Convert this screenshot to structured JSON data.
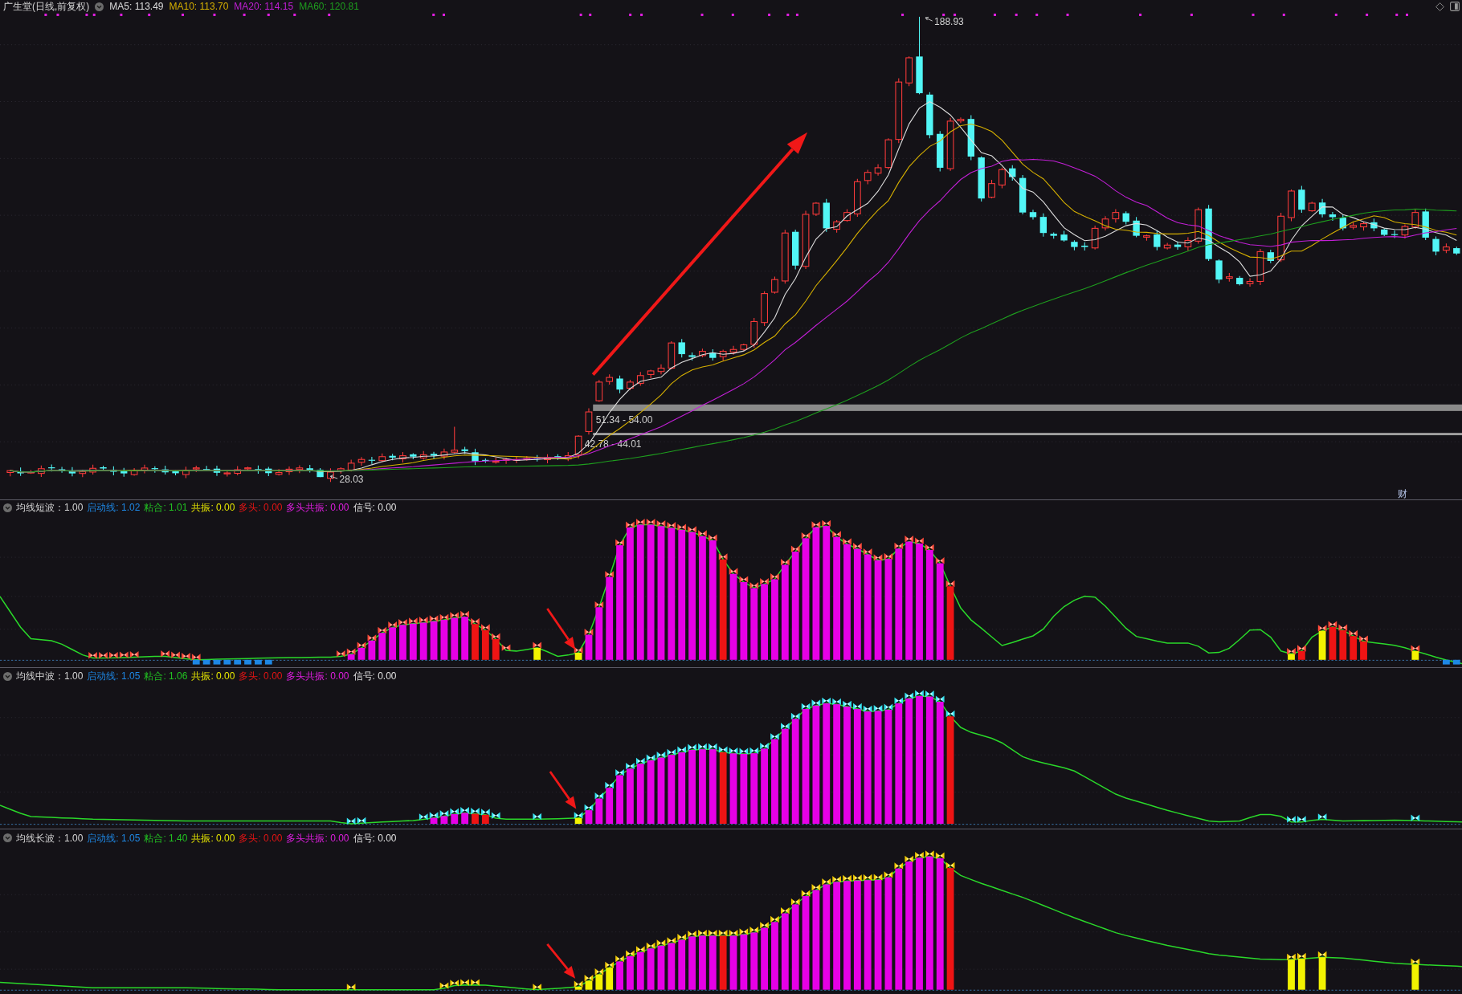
{
  "main_chart": {
    "title": "广生堂(日线,前复权)",
    "legend": [
      {
        "label": "MA5: 113.49",
        "color": "#dcdcdc"
      },
      {
        "label": "MA10: 113.70",
        "color": "#d6b000"
      },
      {
        "label": "MA20: 114.15",
        "color": "#c21fd6"
      },
      {
        "label": "MA60: 120.81",
        "color": "#1e9e1e"
      }
    ],
    "high_label": "188.93",
    "low_label": "28.03",
    "price_bands": [
      {
        "label": "51.34 - 54.00"
      },
      {
        "label": "42.78 - 44.01"
      }
    ],
    "corner_label": "财"
  },
  "indicators": [
    {
      "title": "均线短波：1.00",
      "legend": [
        {
          "label": "启动线: 1.02",
          "color": "#1e88e5"
        },
        {
          "label": "粘合: 1.01",
          "color": "#22c322"
        },
        {
          "label": "共振: 0.00",
          "color": "#e6e600"
        },
        {
          "label": "多头: 0.00",
          "color": "#e41414"
        },
        {
          "label": "多头共振: 0.00",
          "color": "#e11ee1"
        },
        {
          "label": "信号: 0.00",
          "color": "#e0e0e0"
        }
      ]
    },
    {
      "title": "均线中波：1.00",
      "legend": [
        {
          "label": "启动线: 1.05",
          "color": "#1e88e5"
        },
        {
          "label": "粘合: 1.06",
          "color": "#22c322"
        },
        {
          "label": "共振: 0.00",
          "color": "#e6e600"
        },
        {
          "label": "多头: 0.00",
          "color": "#e41414"
        },
        {
          "label": "多头共振: 0.00",
          "color": "#e11ee1"
        },
        {
          "label": "信号: 0.00",
          "color": "#e0e0e0"
        }
      ]
    },
    {
      "title": "均线长波：1.00",
      "legend": [
        {
          "label": "启动线: 1.05",
          "color": "#1e88e5"
        },
        {
          "label": "粘合: 1.40",
          "color": "#22c322"
        },
        {
          "label": "共振: 0.00",
          "color": "#e6e600"
        },
        {
          "label": "多头: 0.00",
          "color": "#e41414"
        },
        {
          "label": "多头共振: 0.00",
          "color": "#e11ee1"
        },
        {
          "label": "信号: 0.00",
          "color": "#e0e0e0"
        }
      ]
    }
  ]
}
